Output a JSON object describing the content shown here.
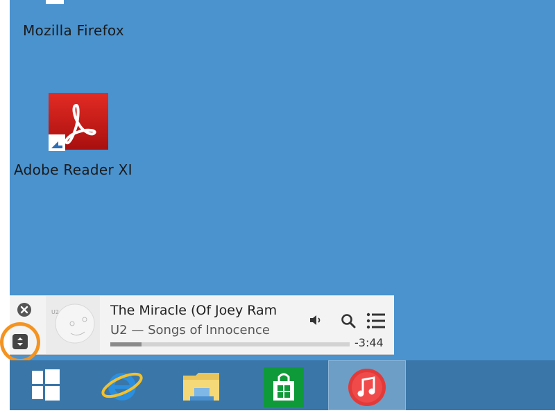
{
  "desktop": {
    "background_color": "#4a93cf",
    "icons": [
      {
        "label": "Mozilla Firefox",
        "icon": "firefox-icon"
      },
      {
        "label": "Adobe Reader XI",
        "icon": "adobe-reader-icon"
      }
    ]
  },
  "mini_player": {
    "title": "The Miracle (Of Joey Ram",
    "subtitle": "U2 — Songs of Innocence",
    "time_remaining": "-3:44",
    "progress": 0.13,
    "controls": [
      "close-icon",
      "volume-icon",
      "search-icon",
      "list-icon",
      "expand-icon"
    ],
    "highlight_color": "#f4931f"
  },
  "taskbar": {
    "background_color": "#3a76a8",
    "items": [
      {
        "icon": "windows-start-icon"
      },
      {
        "icon": "internet-explorer-icon"
      },
      {
        "icon": "file-explorer-icon"
      },
      {
        "icon": "store-icon"
      },
      {
        "icon": "itunes-icon",
        "active": true
      }
    ]
  }
}
